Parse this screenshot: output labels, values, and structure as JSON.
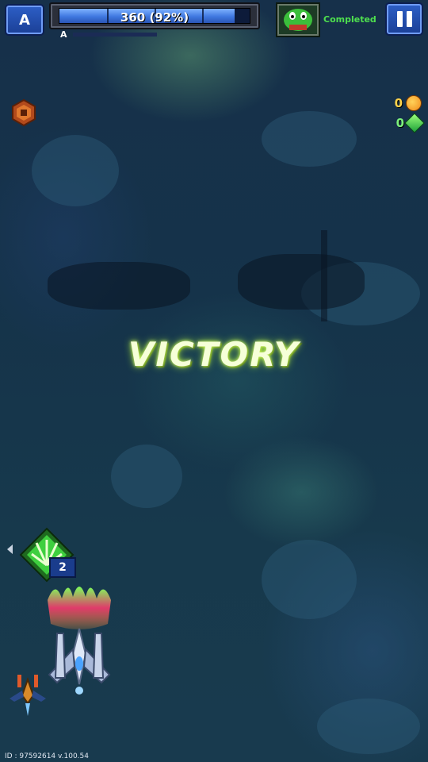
{
  "hud": {
    "rank_label": "A",
    "sub_rank_label": "A",
    "hp_text": "360 (92%)",
    "hp_fraction": 0.92,
    "status_text": "Completed",
    "boss_icon": "green-alien-boss-icon",
    "pause_icon": "pause-icon"
  },
  "resources": {
    "coins": "0",
    "gems": "0"
  },
  "banner": {
    "text": "VICTORY"
  },
  "skill": {
    "icon": "green-burst-skill-icon",
    "count": "2"
  },
  "footer": {
    "id_text": "ID : 97592614   v.100.54"
  },
  "colors": {
    "hud_blue": "#2d5fc7",
    "hp_fill": "#3f78e0",
    "status_green": "#4ee04e",
    "coin_gold": "#ffd24a",
    "victory_glow": "#d6ff6a"
  }
}
